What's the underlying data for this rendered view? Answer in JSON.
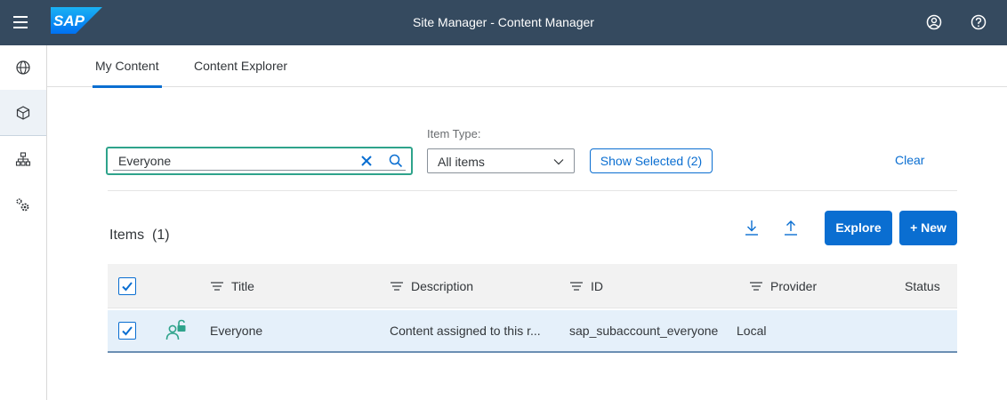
{
  "shell": {
    "title": "Site Manager - Content Manager",
    "logo_text": "SAP",
    "colors": {
      "bar": "#354a5f",
      "logo_start": "#1ab2f3",
      "logo_end": "#0070f2"
    },
    "icons": [
      "menu-icon",
      "user-profile-icon",
      "help-icon"
    ]
  },
  "sidenav": {
    "items": [
      {
        "name": "globe-icon",
        "selected": false
      },
      {
        "name": "cube-icon",
        "selected": true
      },
      {
        "name": "hierarchy-icon",
        "selected": false
      },
      {
        "name": "settings-cogs-icon",
        "selected": false
      }
    ]
  },
  "tabs": [
    {
      "label": "My Content",
      "active": true
    },
    {
      "label": "Content Explorer",
      "active": false
    }
  ],
  "filters": {
    "search_value": "Everyone",
    "item_type_label": "Item Type:",
    "item_type_value": "All items",
    "show_selected_label": "Show Selected (2)",
    "clear_label": "Clear",
    "colors": {
      "search_focus": "#2ea38b",
      "accent": "#0a6ed1"
    }
  },
  "toolbar": {
    "title": "Items",
    "count": "(1)",
    "explore_label": "Explore",
    "new_label": "+ New",
    "icons": [
      "download-icon",
      "upload-icon"
    ]
  },
  "table": {
    "columns": [
      "Title",
      "Description",
      "ID",
      "Provider",
      "Status"
    ],
    "rows": [
      {
        "selected": true,
        "icon": "role-unlocked-icon",
        "title": "Everyone",
        "description": "Content assigned to this r...",
        "id": "sap_subaccount_everyone",
        "provider": "Local",
        "status": ""
      }
    ],
    "colors": {
      "row_selected": "#e5f0fa",
      "row_icon": "#2ea38b"
    }
  }
}
